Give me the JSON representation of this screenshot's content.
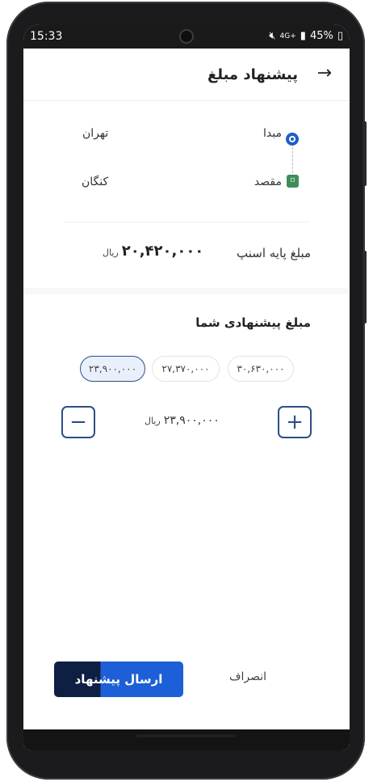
{
  "status_bar": {
    "time": "15:33",
    "network": "4G+",
    "battery": "45%"
  },
  "header": {
    "title": "پیشنهاد مبلغ",
    "back_icon": "arrow-right-icon"
  },
  "trip": {
    "origin_label": "مبدا",
    "origin_value": "تهران",
    "destination_label": "مقصد",
    "destination_value": "کنگان"
  },
  "base_price": {
    "label": "مبلغ پایه اسنپ",
    "amount": "۲۰,۴۲۰,۰۰۰",
    "currency": "ریال"
  },
  "offer": {
    "title": "مبلغ پیشنهادی شما",
    "chips": [
      "۲۳,۹۰۰,۰۰۰",
      "۲۷,۳۷۰,۰۰۰",
      "۳۰,۶۳۰,۰۰۰"
    ],
    "selected_index": 0,
    "current_amount": "۲۳,۹۰۰,۰۰۰",
    "currency": "ریال"
  },
  "actions": {
    "submit_label": "ارسال پیشنهاد",
    "cancel_label": "انصراف"
  },
  "colors": {
    "accent": "#1d5fd6",
    "accent_dark": "#0e1f44",
    "origin": "#1e5ec8",
    "destination": "#3e8e5a"
  }
}
